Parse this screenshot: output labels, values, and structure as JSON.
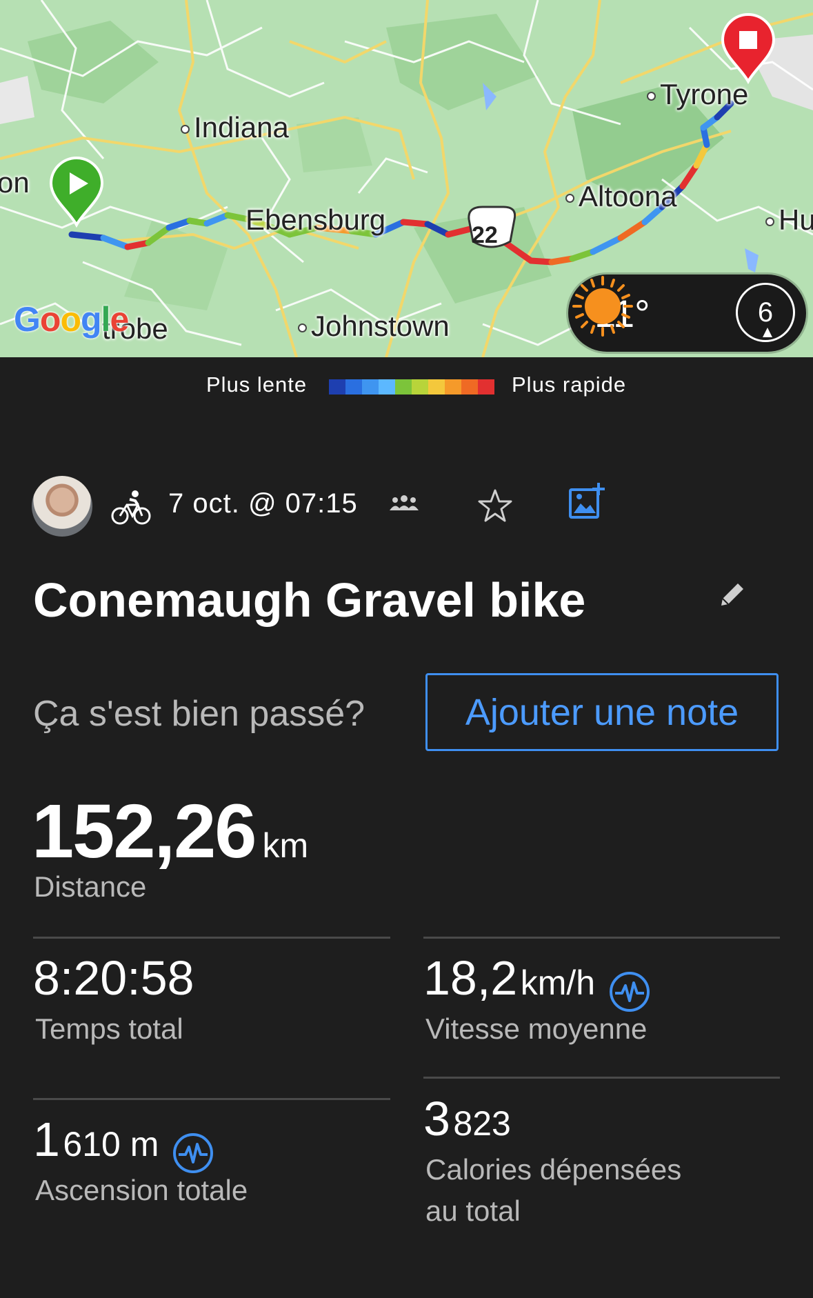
{
  "map": {
    "cities": [
      {
        "name": "Indiana"
      },
      {
        "name": "Ebensburg"
      },
      {
        "name": "Johnstown"
      },
      {
        "name": "Altoona"
      },
      {
        "name": "Tyrone"
      },
      {
        "name": "on"
      },
      {
        "name": "Hu"
      },
      {
        "name": "trobe"
      }
    ],
    "route_shield": "22",
    "attribution": "Google"
  },
  "weather": {
    "temperature": "11°",
    "wind": "6"
  },
  "legend": {
    "slow_label": "Plus lente",
    "fast_label": "Plus rapide",
    "colors": [
      "#1e3fb0",
      "#2a6fe0",
      "#3f95f0",
      "#5cb8ff",
      "#7cc43a",
      "#b8d43a",
      "#f4c83c",
      "#f59a2a",
      "#ef6a24",
      "#e23030"
    ]
  },
  "activity": {
    "date": "7 oct. @ 07:15",
    "title": "Conemaugh Gravel bike",
    "question": "Ça s'est bien passé?",
    "add_note": "Ajouter une note"
  },
  "stats": {
    "distance": {
      "value": "152,26",
      "unit": "km",
      "label": "Distance"
    },
    "total_time": {
      "value": "8:20:58",
      "label": "Temps total"
    },
    "avg_speed": {
      "value": "18,2",
      "unit": "km/h",
      "label": "Vitesse moyenne"
    },
    "ascent": {
      "value": "1",
      "unit": "610 m",
      "label": "Ascension totale"
    },
    "calories": {
      "value": "3",
      "unit": "823",
      "label_line1": "Calories dépensées",
      "label_line2": "au total"
    }
  },
  "colors": {
    "accent": "#3f8ff0",
    "background": "#1e1e1e",
    "secondary_text": "#b9b9b9"
  }
}
